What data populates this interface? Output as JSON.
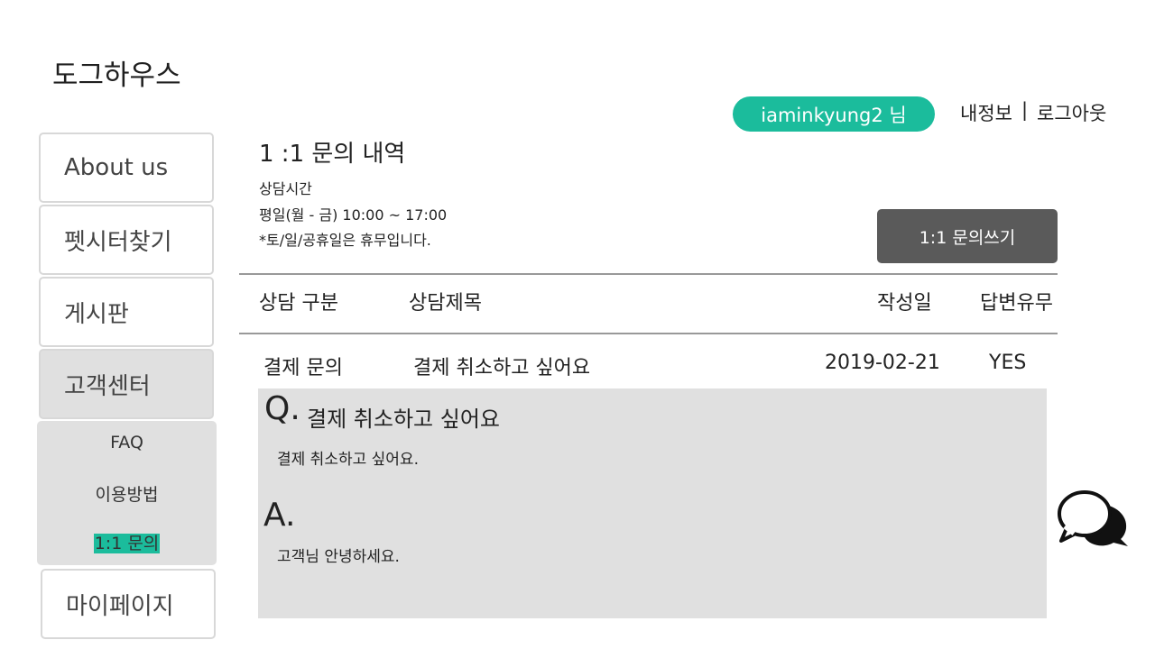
{
  "logo": "도그하우스",
  "header": {
    "user": "iaminkyung2 님",
    "my_info": "내정보",
    "separator": "|",
    "logout": "로그아웃"
  },
  "sidebar": {
    "items": [
      "About us",
      "펫시터찾기",
      "게시판",
      "고객센터"
    ],
    "submenu": [
      "FAQ",
      "이용방법",
      "1:1 문의"
    ],
    "last": "마이페이지"
  },
  "main": {
    "title": "1 :1 문의 내역",
    "hours_label": "상담시간",
    "hours": "평일(월 - 금) 10:00 ~ 17:00",
    "holiday_note": "*토/일/공휴일은 휴무입니다.",
    "write_button": "1:1 문의쓰기"
  },
  "table": {
    "headers": [
      "상담 구분",
      "상담제목",
      "작성일",
      "답변유무"
    ],
    "row": {
      "category": "결제 문의",
      "subject": "결제 취소하고 싶어요",
      "date": "2019-02-21",
      "answered": "YES"
    }
  },
  "detail": {
    "q_prefix": "Q.",
    "q_title": "결제 취소하고 싶어요",
    "q_body": "결제 취소하고 싶어요.",
    "a_prefix": "A.",
    "a_body": "고객님 안녕하세요."
  },
  "icons": {
    "chat": "chat-bubbles-icon"
  },
  "colors": {
    "accent": "#1bbc9c",
    "button_dark": "#5a5a5a",
    "panel_gray": "#e0e0e0"
  }
}
